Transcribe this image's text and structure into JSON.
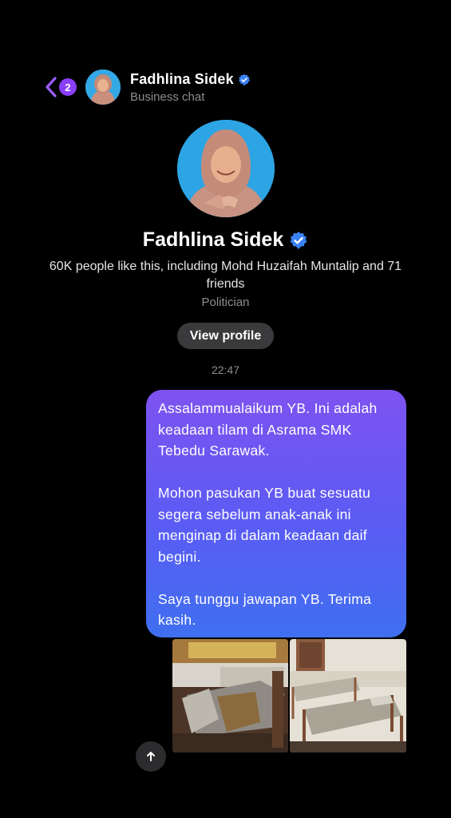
{
  "header": {
    "unread_count": "2",
    "name": "Fadhlina Sidek",
    "subtitle": "Business chat"
  },
  "profile": {
    "name": "Fadhlina Sidek",
    "likes_text": "60K people like this, including Mohd Huzaifah Muntalip and 71 friends",
    "category": "Politician",
    "view_profile_label": "View profile"
  },
  "chat": {
    "timestamp": "22:47",
    "message": {
      "paragraph1": "Assalammualaikum YB. Ini adalah keadaan tilam di Asrama SMK Tebedu Sarawak.",
      "paragraph2": "Mohon pasukan YB buat sesuatu segera sebelum anak-anak ini menginap di dalam keadaan daif begini.",
      "paragraph3": "Saya tunggu jawapan YB. Terima kasih."
    },
    "attachments": [
      "photo-damaged-mattress",
      "photo-dormitory-beds"
    ]
  },
  "colors": {
    "background": "#000000",
    "bubble_gradient_top": "#7e52f0",
    "bubble_gradient_bottom": "#3f6ff0",
    "badge": "#8a3ffc",
    "verified": "#3b82f6",
    "button_bg": "#3a3a3c"
  },
  "icons": {
    "back": "chevron-left-icon",
    "verified": "verified-badge-icon",
    "scroll": "arrow-up-icon"
  }
}
